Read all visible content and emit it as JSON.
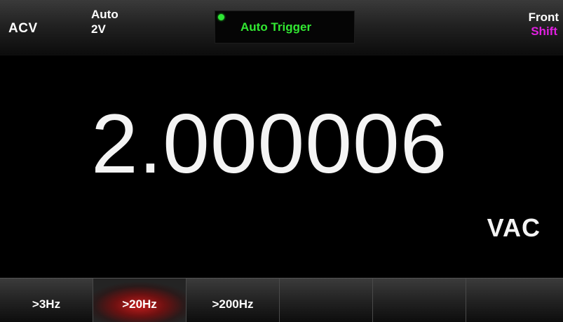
{
  "status_bar": {
    "function": "ACV",
    "range_mode": "Auto",
    "range_value": "2V",
    "trigger_text": "Auto Trigger",
    "trigger_indicator_color": "#2ee835",
    "terminal": "Front",
    "shift": "Shift",
    "shift_color": "#e020e0"
  },
  "measurement": {
    "reading": "2.000006",
    "unit": "VAC"
  },
  "softkeys": [
    {
      "label": ">3Hz",
      "selected": false
    },
    {
      "label": ">20Hz",
      "selected": true
    },
    {
      "label": ">200Hz",
      "selected": false
    },
    {
      "label": "",
      "selected": false
    },
    {
      "label": "",
      "selected": false
    },
    {
      "label": "",
      "selected": false
    }
  ]
}
